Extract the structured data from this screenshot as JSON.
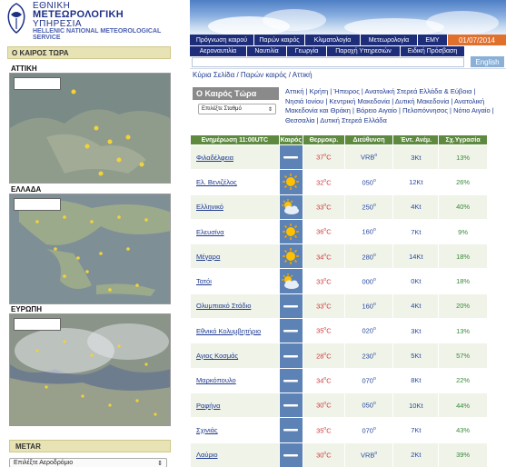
{
  "header": {
    "logo_line1": "ΕΘΝΙΚΗ",
    "logo_line2": "ΜΕΤΕΩΡΟΛΟΓΙΚΗ",
    "logo_line3": "ΥΠΗΡΕΣΙΑ",
    "logo_line4": "HELLENIC NATIONAL METEOROLOGICAL SERVICE",
    "date": "01/07/2014"
  },
  "nav1": [
    "Πρόγνωση καιρού",
    "Παρών καιρός",
    "Κλιματολογία",
    "Μετεωρολογία",
    "ΕΜΥ"
  ],
  "nav2": [
    "Αεροναυτιλία",
    "Ναυτιλία",
    "Γεωργία",
    "Παροχή Υπηρεσιών",
    "Ειδική Πρόσβαση"
  ],
  "search": {
    "value": "",
    "lang_button": "English"
  },
  "breadcrumb": "Κύρια Σελίδα / Παρών καιρός / Αττική",
  "sidebar": {
    "header": "Ο ΚΑΙΡΟΣ ΤΩΡΑ",
    "regions": [
      "ΑΤΤΙΚΗ",
      "ΕΛΛΑΔΑ",
      "ΕΥΡΩΠΗ"
    ],
    "metar_header": "METAR",
    "metar_select": "Επιλέξτε Αεροδρόμιο"
  },
  "now": {
    "title": "Ο Καιρός Τώρα",
    "select": "Επιλέξτε Σταθμό"
  },
  "regions_links": "Αττική | Κρήτη | Ήπειρος | Ανατολική Στερεά Ελλάδα & Εύβοια | Νησιά Ιονίου | Κεντρική Μακεδονία | Δυτική Μακεδονία | Ανατολική Μακεδονία και Θράκη | Βόρειο Αιγαίο | Πελοπόννησος | Νότιο Αιγαίο | Θεσσαλία | Δυτική Στερεά Ελλάδα",
  "table": {
    "headers": [
      "Ενημέρωση 11:00UTC",
      "Καιρός",
      "Θερμοκρ.",
      "Διεύθυνση",
      "Έντ. Ανέμ.",
      "Σχ.Υγρασία"
    ],
    "rows": [
      {
        "station": "Φιλαδέλφεια",
        "icon": "clear-icon",
        "temp": "37",
        "dir": "VRB",
        "wind": "3Kt",
        "hum": "13%"
      },
      {
        "station": "Ελ. Βενιζέλος",
        "icon": "sun-icon",
        "temp": "32",
        "dir": "050",
        "wind": "12Kt",
        "hum": "26%"
      },
      {
        "station": "Ελληνικό",
        "icon": "partly-cloudy-icon",
        "temp": "33",
        "dir": "250",
        "wind": "4Kt",
        "hum": "40%"
      },
      {
        "station": "Ελευσίνα",
        "icon": "sun-icon",
        "temp": "36",
        "dir": "160",
        "wind": "7Kt",
        "hum": "9%"
      },
      {
        "station": "Μέγαρα",
        "icon": "sun-icon",
        "temp": "34",
        "dir": "280",
        "wind": "14Kt",
        "hum": "18%"
      },
      {
        "station": "Τατόι",
        "icon": "partly-cloudy-icon",
        "temp": "33",
        "dir": "000",
        "wind": "0Kt",
        "hum": "18%"
      },
      {
        "station": "Ολυμπιακό Στάδιο",
        "icon": "clear-icon",
        "temp": "33",
        "dir": "160",
        "wind": "4Kt",
        "hum": "20%"
      },
      {
        "station": "Εθνικό Κολυμβητήριο",
        "icon": "clear-icon",
        "temp": "35",
        "dir": "020",
        "wind": "3Kt",
        "hum": "13%"
      },
      {
        "station": "Αγιος Κοσμάς",
        "icon": "clear-icon",
        "temp": "28",
        "dir": "230",
        "wind": "5Kt",
        "hum": "57%"
      },
      {
        "station": "Μαρκόπουλο",
        "icon": "clear-icon",
        "temp": "34",
        "dir": "070",
        "wind": "8Kt",
        "hum": "22%"
      },
      {
        "station": "Ραφήνα",
        "icon": "clear-icon",
        "temp": "30",
        "dir": "050",
        "wind": "10Kt",
        "hum": "44%"
      },
      {
        "station": "Σχινιάς",
        "icon": "clear-icon",
        "temp": "35",
        "dir": "070",
        "wind": "7Kt",
        "hum": "43%"
      },
      {
        "station": "Λαύριο",
        "icon": "clear-icon",
        "temp": "30",
        "dir": "VRB",
        "wind": "2Kt",
        "hum": "39%"
      }
    ],
    "temp_unit": "o",
    "temp_unit_c": "C",
    "dir_unit": "o"
  },
  "colors": {
    "nav": "#1e2d7a",
    "date": "#e0702e",
    "table_header": "#5d8a3f",
    "icon_cell": "#5d82b5",
    "temp": "#d23a3a",
    "dir": "#2a4aa0",
    "hum": "#3b8a3b"
  }
}
